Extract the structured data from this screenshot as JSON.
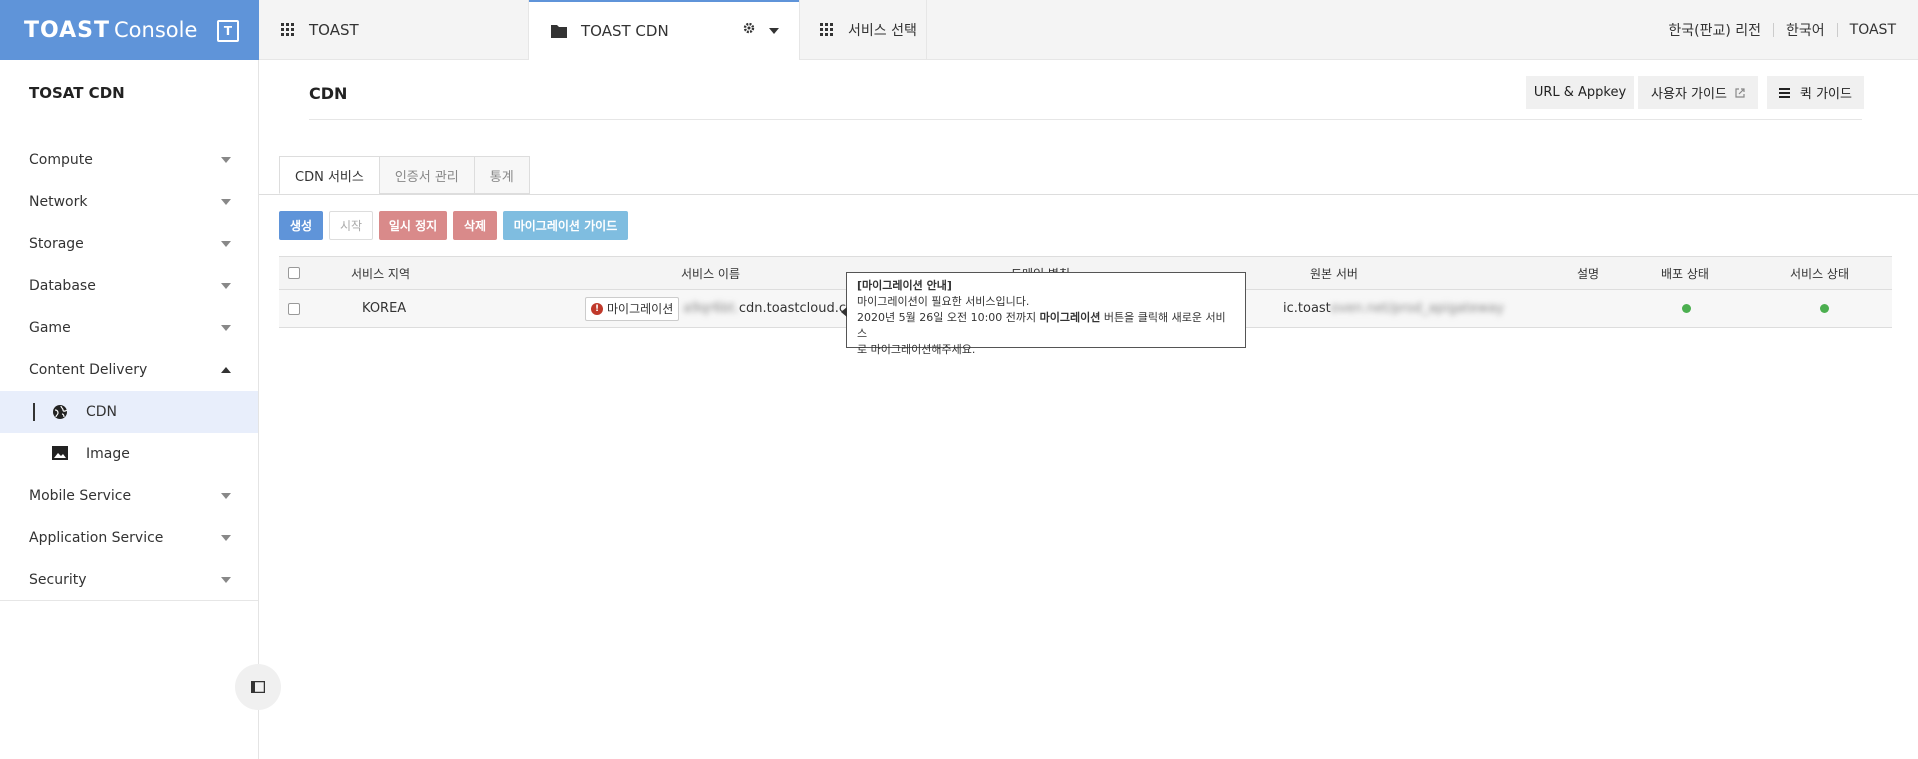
{
  "header": {
    "brand": "TOAST",
    "console": "Console",
    "badge": "T",
    "tabs": [
      {
        "label": "TOAST",
        "icon": "grid-icon"
      },
      {
        "label": "TOAST CDN",
        "icon": "folder-icon"
      },
      {
        "label": "서비스 선택",
        "icon": "grid-icon"
      }
    ],
    "region": "한국(판교) 리전",
    "language": "한국어",
    "user": "TOAST",
    "accent": "#5f94d9"
  },
  "sidebar": {
    "title": "TOSAT CDN",
    "items": [
      {
        "label": "Compute"
      },
      {
        "label": "Network"
      },
      {
        "label": "Storage"
      },
      {
        "label": "Database"
      },
      {
        "label": "Game"
      },
      {
        "label": "Content Delivery"
      },
      {
        "label": "Mobile Service"
      },
      {
        "label": "Application Service"
      },
      {
        "label": "Security"
      }
    ],
    "sub_items": [
      {
        "label": "CDN",
        "icon": "globe-icon"
      },
      {
        "label": "Image",
        "icon": "image-icon"
      }
    ]
  },
  "main": {
    "title": "CDN",
    "header_buttons": {
      "appkey": "URL & Appkey",
      "user_guide": "사용자 가이드",
      "quick_guide": "퀵 가이드"
    },
    "tabs": [
      {
        "label": "CDN 서비스"
      },
      {
        "label": "인증서 관리"
      },
      {
        "label": "통계"
      }
    ],
    "actions": {
      "create": "생성",
      "start": "시작",
      "pause": "일시 정지",
      "delete": "삭제",
      "migration_guide": "마이그레이션 가이드"
    },
    "table": {
      "columns": [
        "서비스 지역",
        "서비스 이름",
        "도메인 별칭",
        "원본 서버",
        "설명",
        "배포 상태",
        "서비스 상태"
      ],
      "rows": [
        {
          "region": "KOREA",
          "migrate_label": "마이그레이션",
          "service_name_blurred": "a9qr6bt.",
          "service_name_domain": "cdn.toastcloud.com",
          "origin_prefix": "ic.toast",
          "origin_blurred": "oven.net/prod_apigateway",
          "deploy_status": "active",
          "service_status": "active"
        }
      ]
    },
    "tooltip": {
      "title": "[마이그레이션 안내]",
      "line1": "마이그레이션이 필요한 서비스입니다.",
      "line2_pre": "2020년 5월 26일 오전 10:00 전까지 ",
      "line2_bold": "마이그레이션",
      "line2_post": " 버튼을 클릭해 새로운 서비스",
      "line3": "로 마이그레이션해주세요."
    }
  }
}
